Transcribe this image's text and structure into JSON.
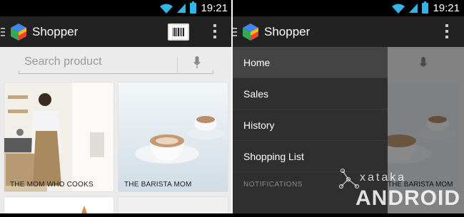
{
  "status_bar": {
    "time": "19:21"
  },
  "left_screen": {
    "app_title": "Shopper",
    "search_placeholder": "Search product",
    "cards": [
      {
        "label": "THE MOM WHO COOKS"
      },
      {
        "label": "THE BARISTA MOM"
      }
    ]
  },
  "right_screen": {
    "app_title": "Shopper",
    "drawer": {
      "items": [
        {
          "label": "Home"
        },
        {
          "label": "Sales"
        },
        {
          "label": "History"
        },
        {
          "label": "Shopping List"
        }
      ],
      "section_header": "NOTIFICATIONS"
    },
    "card_label_partial": "THE BARISTA MOM"
  },
  "watermark": {
    "top": "xataka",
    "bottom": "ANDROID"
  },
  "colors": {
    "accent": "#33b5e5",
    "action_bar": "#222222",
    "drawer": "#2f2f2f"
  }
}
